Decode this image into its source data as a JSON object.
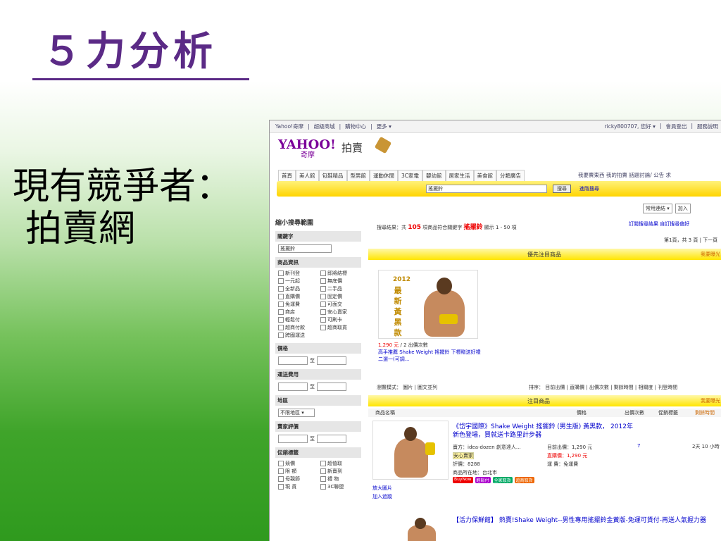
{
  "slide": {
    "title": "５力分析",
    "subtitle_line1": "現有競爭者：",
    "subtitle_line2": "拍賣網"
  },
  "screenshot": {
    "topbar_left": [
      "Yahoo!奇摩",
      "超級商城",
      "購物中心",
      "更多 ▾"
    ],
    "topbar_right": [
      "ricky800707, 您好 ▾",
      "會員登出",
      "服務說明"
    ],
    "logo_main": "YAHOO!",
    "logo_sub": "奇摩",
    "brand": "拍賣",
    "nav": [
      "首頁",
      "美人館",
      "包鞋精品",
      "型男館",
      "運動休閒",
      "3C家電",
      "嬰幼館",
      "居家生活",
      "美食館",
      "分類廣告"
    ],
    "nav_right": "我要賣東西  我的拍賣  話題討論/ 公告  求",
    "search_value": "搖擺鈴",
    "search_button": "搜尋",
    "advanced_search": "進階搜尋",
    "tools": [
      "常用連結 ▾",
      "加入"
    ],
    "sidebar": {
      "header": "縮小搜尋範圍",
      "keyword_label": "關鍵字",
      "keyword_value": "搖擺鈴",
      "product_info_label": "商品資訊",
      "product_info_options": [
        "新刊登",
        "即將結標",
        "一元起",
        "無底價",
        "全新品",
        "二手品",
        "直購價",
        "固定價",
        "免運費",
        "可面交",
        "商店",
        "安心賣家",
        "輕鬆付",
        "可刷卡",
        "超商付款",
        "超商取貨",
        "跨國運送"
      ],
      "price_label": "價格",
      "shipping_label": "運送費用",
      "range_to": "至",
      "region_label": "地區",
      "region_value": "不限地區 ▾",
      "seller_rating_label": "賣家評價",
      "promo_label": "促銷標籤",
      "promo_options": [
        "競價",
        "超值取",
        "限 額",
        "新賣到",
        "母親節",
        "禮 物",
        "現 貨",
        "3C聯盟"
      ]
    },
    "results": {
      "summary_prefix": "搜尋結果：共",
      "count": "105",
      "summary_mid": "項商品符合關鍵字",
      "keyword": "搖擺鈴",
      "summary_suffix": "顯示 1 - 50 項",
      "subscribe": "訂閱搜尋結果   自訂搜尋偏好",
      "pagination": "第1頁，共 3 頁 | 下一頁",
      "featured_band": "優先注目商品",
      "featured_band_right": "我要曝光",
      "featured_badge": [
        "2012",
        "最",
        "新",
        "黃",
        "黑",
        "款"
      ],
      "featured_price": "1,290 元",
      "featured_bids": "/ 2 出價次數",
      "featured_desc": "高手推薦 Shake Weight 搖擺鈴 下標贈送好禮二選一(可調...",
      "view_mode": "瀏覽模式： 圖片 | 圖文並列",
      "sort": "排序： 目前出價 | 直購價 | 出價次數 | 剩餘時間 | 相關度 | 刊登時間",
      "listing_band": "注目商品",
      "listing_band_right": "我要曝光",
      "columns": [
        "商品名稱",
        "價格",
        "出價次數",
        "促銷標籤",
        "剩餘時間"
      ],
      "item1_title": "《岱宇國際》Shake Weight 搖擺鈴 (男生版) 黃黑款， 2012年新色登場，買就送卡路里計步器",
      "item1_seller": "賣方：idea-dozen 創意達人...",
      "item1_seller_tag": "安心賣家",
      "item1_rating": "評價：8288",
      "item1_location": "商品所在地：台北市",
      "item1_current_bid": "目前出價：1,290 元",
      "item1_buy_now": "直購價：1,290 元",
      "item1_shipping": "運  費：免運費",
      "item1_bids": "7",
      "item1_time": "2天 10 小時",
      "item1_links": [
        "放大圖片",
        "加入追蹤"
      ],
      "item1_badges": [
        "BuyNow",
        "輕鬆付",
        "全家取貨",
        "超商取貨"
      ],
      "item2_title": "【活力保鮮館】 熱賣!Shake Weight--男性專用搖擺鈴金黃版-免運可貨付-再送人氣握力器"
    }
  }
}
